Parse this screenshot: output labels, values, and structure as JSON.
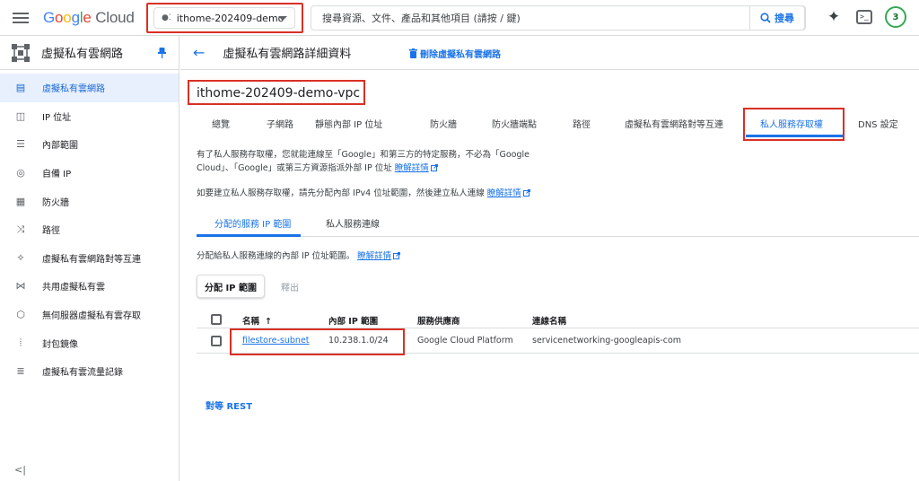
{
  "topbar": {
    "logo_letters": [
      "G",
      "o",
      "o",
      "g",
      "l",
      "e"
    ],
    "logo_cloud": "Cloud",
    "project": "ithome-202409-demo",
    "search_placeholder": "搜尋資源、文件、產品和其他項目 (請按 / 鍵)",
    "search_button": "搜尋",
    "notifications_count": "3"
  },
  "sidebar": {
    "title": "虛擬私有雲網路",
    "items": [
      {
        "label": "虛擬私有雲網路",
        "icon": "vpc-network-icon",
        "active": true
      },
      {
        "label": "IP 位址",
        "icon": "ip-address-icon"
      },
      {
        "label": "內部範圍",
        "icon": "internal-range-icon"
      },
      {
        "label": "自備 IP",
        "icon": "byoip-icon"
      },
      {
        "label": "防火牆",
        "icon": "firewall-icon"
      },
      {
        "label": "路徑",
        "icon": "route-icon"
      },
      {
        "label": "虛擬私有雲網路對等互連",
        "icon": "peering-icon"
      },
      {
        "label": "共用虛擬私有雲",
        "icon": "shared-vpc-icon"
      },
      {
        "label": "無伺服器虛擬私有雲存取",
        "icon": "serverless-access-icon"
      },
      {
        "label": "封包鏡像",
        "icon": "packet-mirroring-icon"
      },
      {
        "label": "虛擬私有雲流量記錄",
        "icon": "flow-logs-icon"
      }
    ],
    "collapse_label": "<|"
  },
  "main": {
    "page_title": "虛擬私有雲網路詳細資料",
    "delete_label": "刪除虛擬私有雲網路",
    "vpc_name": "ithome-202409-demo-vpc",
    "tabs": [
      "總覽",
      "子網路",
      "靜態內部 IP 位址",
      "防火牆",
      "防火牆端點",
      "路徑",
      "虛擬私有雲網路對等互連",
      "私人服務存取權",
      "DNS 設定"
    ],
    "active_tab": "私人服務存取權",
    "intro_line1": "有了私人服務存取權，您就能連線至「Google」和第三方的特定服務，不必為「Google",
    "intro_line2": "Cloud」、「Google」或第三方資源指派外部 IP 位址",
    "learn_more": "瞭解詳情",
    "setup_text": "如要建立私人服務存取權，請先分配內部 IPv4 位址範圍，然後建立私人連線",
    "subtabs": [
      "分配的服務 IP 範圍",
      "私人服務連線"
    ],
    "alloc_desc": "分配給私人服務連線的內部 IP 位址範圍。",
    "alloc_button": "分配 IP 範圍",
    "release_button": "釋出",
    "table": {
      "headers": [
        "名稱",
        "內部 IP 範圍",
        "服務供應商",
        "連線名稱"
      ],
      "sort_arrow": "↑",
      "rows": [
        {
          "name": "filestore-subnet",
          "range": "10.238.1.0/24",
          "provider": "Google Cloud Platform",
          "connection": "servicenetworking-googleapis-com"
        }
      ]
    },
    "peer_rest": "對等 REST"
  },
  "colors": {
    "accent": "#1a73e8",
    "highlight_box": "#d93025",
    "active_bg": "#e8f0fe"
  }
}
